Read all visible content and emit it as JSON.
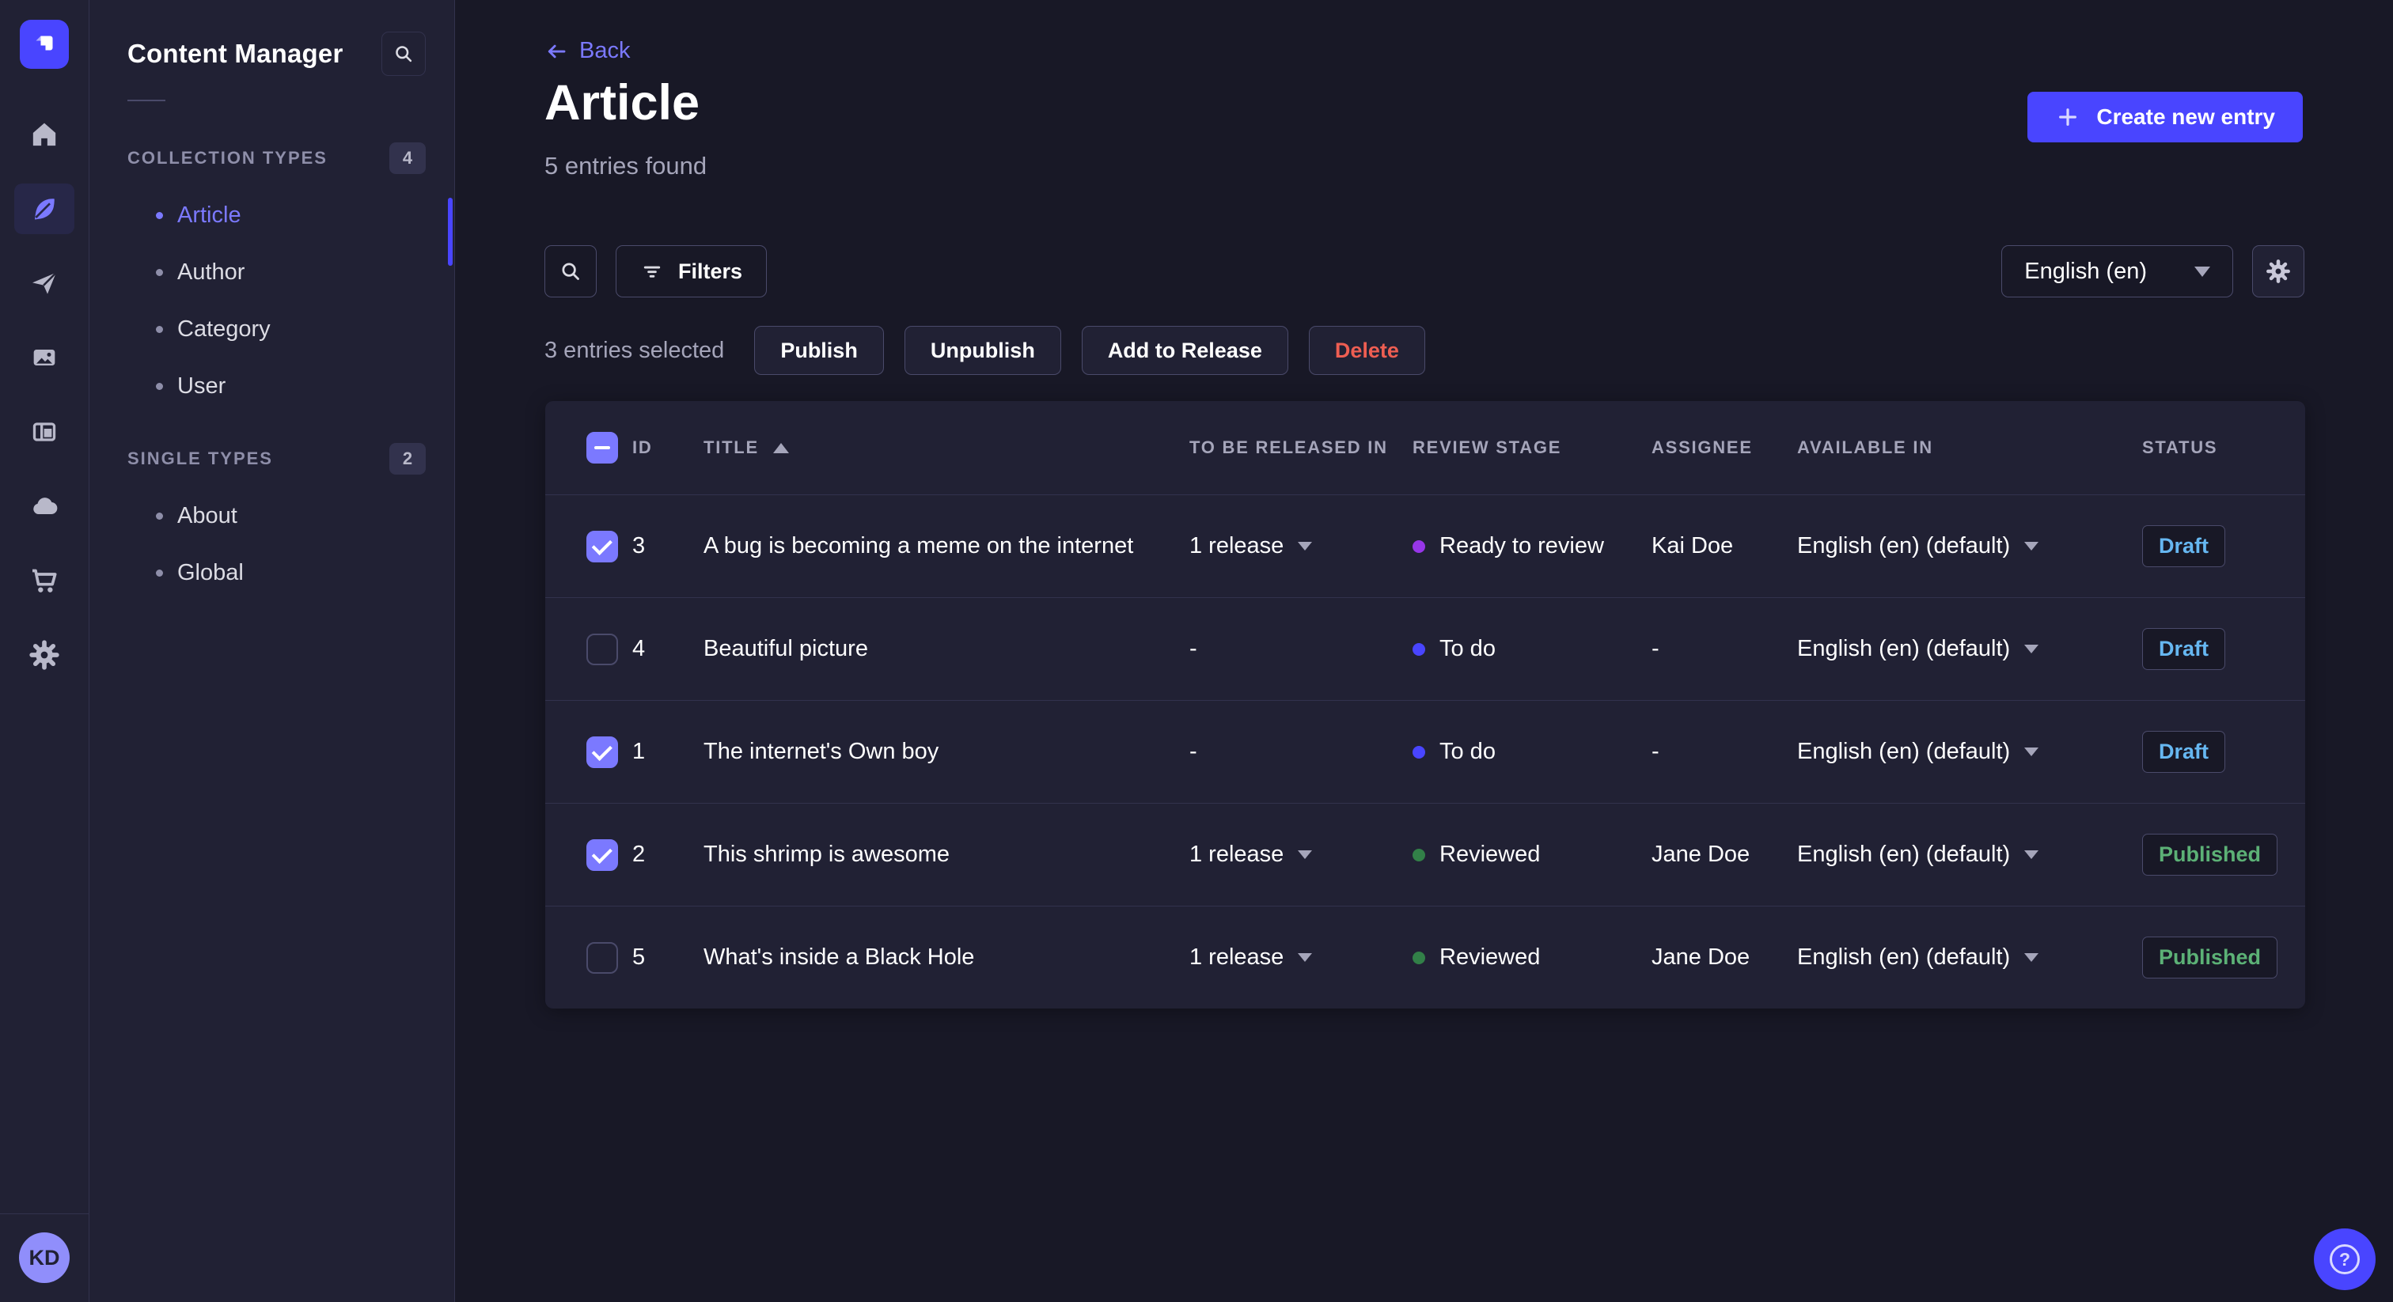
{
  "brand_color": "#4945ff",
  "nav_rail": {
    "icons": [
      "home",
      "content-manager",
      "releases",
      "media-library",
      "content-type-builder",
      "deploy",
      "marketplace",
      "settings"
    ],
    "active_icon": "content-manager"
  },
  "user": {
    "initials": "KD"
  },
  "subnav": {
    "title": "Content Manager",
    "search_icon": "search",
    "sections": [
      {
        "label": "COLLECTION TYPES",
        "count": "4",
        "items": [
          {
            "label": "Article",
            "active": true
          },
          {
            "label": "Author"
          },
          {
            "label": "Category"
          },
          {
            "label": "User"
          }
        ]
      },
      {
        "label": "SINGLE TYPES",
        "count": "2",
        "items": [
          {
            "label": "About"
          },
          {
            "label": "Global"
          }
        ]
      }
    ]
  },
  "header": {
    "back_label": "Back",
    "title": "Article",
    "subtitle": "5 entries found",
    "create_button": "Create new entry"
  },
  "toolbar": {
    "search_icon": "search",
    "filters_label": "Filters",
    "locale": "English (en)",
    "settings_icon": "gear"
  },
  "selection": {
    "text": "3 entries selected",
    "publish": "Publish",
    "unpublish": "Unpublish",
    "add_to_release": "Add to Release",
    "delete": "Delete"
  },
  "table": {
    "columns": [
      "ID",
      "TITLE",
      "TO BE RELEASED IN",
      "REVIEW STAGE",
      "ASSIGNEE",
      "AVAILABLE IN",
      "STATUS"
    ],
    "sorted_column": "TITLE",
    "sort_direction": "asc",
    "rows": [
      {
        "selected": true,
        "id": "3",
        "title": "A bug is becoming a meme on the internet",
        "releases": "1 release",
        "review_stage": "Ready to review",
        "assignee": "Kai Doe",
        "available_in": "English (en) (default)",
        "status": "Draft"
      },
      {
        "selected": false,
        "id": "4",
        "title": "Beautiful picture",
        "releases": "-",
        "review_stage": "To do",
        "assignee": "-",
        "available_in": "English (en) (default)",
        "status": "Draft"
      },
      {
        "selected": true,
        "id": "1",
        "title": "The internet's Own boy",
        "releases": "-",
        "review_stage": "To do",
        "assignee": "-",
        "available_in": "English (en) (default)",
        "status": "Draft"
      },
      {
        "selected": true,
        "id": "2",
        "title": "This shrimp is awesome",
        "releases": "1 release",
        "review_stage": "Reviewed",
        "assignee": "Jane Doe",
        "available_in": "English (en) (default)",
        "status": "Published"
      },
      {
        "selected": false,
        "id": "5",
        "title": "What's inside a Black Hole",
        "releases": "1 release",
        "review_stage": "Reviewed",
        "assignee": "Jane Doe",
        "available_in": "English (en) (default)",
        "status": "Published"
      }
    ]
  },
  "review_stage_colors": {
    "To do": "#4945ff",
    "Ready to review": "#9736e8",
    "Reviewed": "#328048"
  },
  "status_colors": {
    "Draft": "#66b7f1",
    "Published": "#5cb176"
  },
  "help": {
    "icon": "question-mark"
  }
}
